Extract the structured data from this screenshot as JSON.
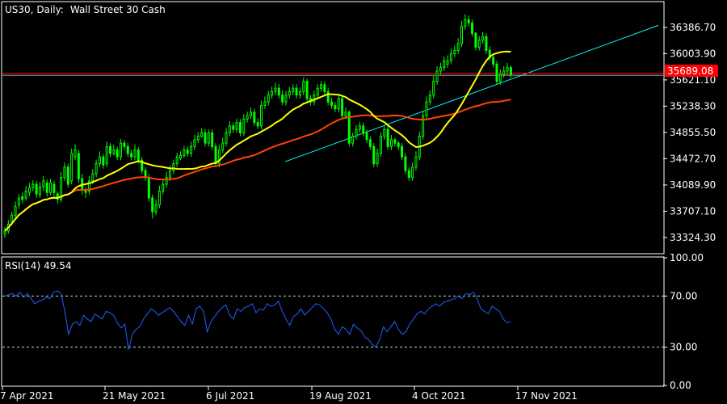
{
  "header": {
    "symbol": "US30",
    "timeframe": "Daily:",
    "instrument": "Wall Street 30 Cash"
  },
  "colors": {
    "background": "#000000",
    "frame": "#ffffff",
    "candle": "#00ff00",
    "ma_fast": "#ffff00",
    "ma_slow": "#ff4500",
    "trendline": "#00ffff",
    "price_line": "#ff0000",
    "rsi": "#1e60ff",
    "level_line": "#d3d3d3"
  },
  "chart_data": [
    {
      "type": "candlestick",
      "title": "US30, Daily:  Wall Street 30 Cash",
      "x_tick_labels": [
        "7 Apr 2021",
        "21 May 2021",
        "6 Jul 2021",
        "19 Aug 2021",
        "4 Oct 2021",
        "17 Nov 2021"
      ],
      "y_tick_labels": [
        "36386.70",
        "36003.90",
        "35621.10",
        "35238.30",
        "34855.50",
        "34472.70",
        "34089.90",
        "33707.10",
        "33324.30"
      ],
      "ylim": [
        33100,
        36750
      ],
      "current_price_label": "35689.08",
      "current_price": 35689.08,
      "horizontal_line": 35720,
      "trendline": {
        "from": [
          0.5,
          32960
        ],
        "to": [
          58.2,
          35550
        ]
      },
      "series": [
        {
          "type": "candle",
          "close": [
            33420,
            33520,
            33650,
            33780,
            33900,
            33880,
            34000,
            34050,
            34100,
            33960,
            34060,
            34150,
            33980,
            34120,
            33980,
            33880,
            34200,
            34350,
            34100,
            34550,
            34600,
            34180,
            34020,
            33980,
            34150,
            34250,
            34400,
            34500,
            34380,
            34650,
            34550,
            34600,
            34500,
            34700,
            34650,
            34550,
            34500,
            34600,
            34450,
            34300,
            34200,
            33900,
            33700,
            33800,
            34000,
            34100,
            34200,
            34300,
            34400,
            34500,
            34520,
            34600,
            34550,
            34650,
            34750,
            34800,
            34850,
            34700,
            34850,
            34650,
            34400,
            34600,
            34700,
            34850,
            34950,
            34900,
            35000,
            34850,
            35050,
            35100,
            35150,
            35000,
            34950,
            35250,
            35300,
            35400,
            35450,
            35500,
            35400,
            35300,
            35400,
            35450,
            35500,
            35400,
            35450,
            35600,
            35350,
            35300,
            35400,
            35500,
            35550,
            35450,
            35300,
            35250,
            35200,
            35350,
            35100,
            35150,
            34700,
            34800,
            34900,
            34950,
            34850,
            34750,
            34650,
            34400,
            34550,
            34800,
            34900,
            34650,
            34750,
            34700,
            34650,
            34500,
            34300,
            34200,
            34350,
            34500,
            34800,
            35100,
            35300,
            35400,
            35600,
            35750,
            35800,
            35900,
            35900,
            36000,
            36050,
            36150,
            36400,
            36500,
            36450,
            36300,
            36100,
            36200,
            36250,
            36050,
            35950,
            35850,
            35600,
            35700,
            35750,
            35800,
            35700
          ],
          "open": [
            33380,
            33420,
            33550,
            33650,
            33800,
            33920,
            33900,
            33980,
            34050,
            34100,
            33950,
            34060,
            34120,
            33980,
            34100,
            33960,
            33880,
            34200,
            34350,
            34150,
            34500,
            34550,
            34180,
            34020,
            34000,
            34150,
            34250,
            34400,
            34500,
            34400,
            34650,
            34550,
            34600,
            34500,
            34700,
            34650,
            34550,
            34500,
            34600,
            34450,
            34300,
            34200,
            33900,
            33700,
            33800,
            34000,
            34100,
            34200,
            34300,
            34400,
            34480,
            34520,
            34600,
            34550,
            34650,
            34750,
            34800,
            34850,
            34700,
            34850,
            34650,
            34400,
            34600,
            34700,
            34850,
            34950,
            34900,
            35000,
            34850,
            35050,
            35100,
            35150,
            35000,
            34950,
            35250,
            35300,
            35400,
            35450,
            35500,
            35400,
            35300,
            35400,
            35450,
            35500,
            35400,
            35450,
            35600,
            35350,
            35300,
            35400,
            35500,
            35550,
            35450,
            35300,
            35250,
            35200,
            35350,
            35100,
            35150,
            34700,
            34800,
            34900,
            34950,
            34850,
            34750,
            34650,
            34400,
            34550,
            34800,
            34900,
            34650,
            34750,
            34700,
            34650,
            34500,
            34300,
            34200,
            34350,
            34500,
            34800,
            35100,
            35300,
            35400,
            35600,
            35750,
            35800,
            35850,
            35900,
            36000,
            36050,
            36150,
            36400,
            36500,
            36450,
            36300,
            36100,
            36200,
            36250,
            36050,
            35950,
            35850,
            35600,
            35700,
            35750,
            35800
          ],
          "high": [
            33480,
            33580,
            33700,
            33850,
            33960,
            33980,
            34080,
            34120,
            34160,
            34150,
            34130,
            34220,
            34170,
            34180,
            34150,
            34000,
            34280,
            34420,
            34400,
            34620,
            34680,
            34600,
            34250,
            34060,
            34220,
            34320,
            34460,
            34580,
            34540,
            34720,
            34700,
            34680,
            34650,
            34760,
            34740,
            34700,
            34600,
            34680,
            34640,
            34500,
            34350,
            34250,
            33950,
            33880,
            34080,
            34180,
            34280,
            34380,
            34460,
            34560,
            34580,
            34660,
            34650,
            34720,
            34820,
            34860,
            34920,
            34900,
            34900,
            34900,
            34700,
            34680,
            34780,
            34920,
            35020,
            35000,
            35060,
            35050,
            35120,
            35160,
            35220,
            35200,
            35060,
            35320,
            35380,
            35460,
            35520,
            35580,
            35560,
            35460,
            35460,
            35520,
            35560,
            35560,
            35510,
            35660,
            35640,
            35400,
            35460,
            35560,
            35600,
            35600,
            35500,
            35360,
            35300,
            35420,
            35400,
            35220,
            35180,
            34850,
            34960,
            35010,
            35000,
            34900,
            34800,
            34700,
            34620,
            34860,
            34960,
            34950,
            34820,
            34780,
            34730,
            34700,
            34550,
            34340,
            34420,
            34580,
            34870,
            35170,
            35380,
            35470,
            35680,
            35820,
            35870,
            35960,
            35980,
            36080,
            36120,
            36230,
            36480,
            36580,
            36560,
            36500,
            36320,
            36260,
            36320,
            36300,
            36110,
            36000,
            35900,
            35780,
            35820,
            35870,
            35830
          ],
          "low": [
            33320,
            33380,
            33500,
            33600,
            33740,
            33820,
            33860,
            33930,
            34000,
            33900,
            33900,
            34000,
            33920,
            33940,
            33920,
            33820,
            33840,
            34150,
            34050,
            34100,
            34450,
            34120,
            33950,
            33900,
            33950,
            34100,
            34200,
            34350,
            34330,
            34350,
            34500,
            34520,
            34450,
            34450,
            34600,
            34500,
            34450,
            34450,
            34400,
            34250,
            34150,
            33850,
            33600,
            33650,
            33750,
            33950,
            34050,
            34150,
            34250,
            34350,
            34450,
            34480,
            34500,
            34500,
            34600,
            34700,
            34780,
            34650,
            34650,
            34600,
            34350,
            34350,
            34550,
            34650,
            34800,
            34850,
            34850,
            34800,
            34800,
            35000,
            35050,
            34950,
            34900,
            34900,
            35200,
            35250,
            35350,
            35400,
            35350,
            35250,
            35250,
            35350,
            35400,
            35350,
            35350,
            35400,
            35300,
            35250,
            35250,
            35350,
            35450,
            35400,
            35250,
            35200,
            35150,
            35150,
            35050,
            35050,
            34650,
            34650,
            34750,
            34850,
            34800,
            34700,
            34600,
            34350,
            34350,
            34500,
            34750,
            34600,
            34600,
            34650,
            34600,
            34450,
            34250,
            34150,
            34150,
            34300,
            34450,
            34750,
            35050,
            35250,
            35350,
            35550,
            35700,
            35750,
            35800,
            35850,
            35950,
            36000,
            36100,
            36350,
            36400,
            36250,
            36050,
            36050,
            36150,
            36000,
            35900,
            35800,
            35550,
            35550,
            35650,
            35700,
            35650
          ]
        },
        {
          "type": "line",
          "name": "",
          "role": "ma_fast"
        },
        {
          "type": "line",
          "name": "",
          "role": "ma_slow"
        }
      ]
    },
    {
      "type": "line",
      "title": "RSI(14) 49.54",
      "indicator_label": "RSI(14)",
      "indicator_value": "49.54",
      "y_tick_labels": [
        "100.00",
        "70.00",
        "30.00",
        "0.00"
      ],
      "ylim": [
        0,
        100
      ],
      "levels": [
        70,
        30
      ],
      "values": [
        70,
        71,
        72,
        70,
        73,
        69,
        72,
        68,
        64,
        66,
        67,
        69,
        68,
        73,
        74,
        72,
        58,
        40,
        48,
        50,
        47,
        55,
        52,
        50,
        56,
        54,
        52,
        58,
        57,
        55,
        49,
        45,
        48,
        28,
        40,
        44,
        46,
        52,
        56,
        60,
        58,
        55,
        57,
        59,
        61,
        58,
        54,
        50,
        47,
        55,
        48,
        60,
        62,
        58,
        42,
        50,
        54,
        58,
        61,
        63,
        55,
        52,
        60,
        58,
        61,
        62,
        64,
        57,
        60,
        59,
        64,
        62,
        63,
        66,
        58,
        52,
        47,
        54,
        56,
        60,
        55,
        58,
        61,
        64,
        63,
        60,
        57,
        52,
        44,
        40,
        46,
        44,
        40,
        48,
        45,
        43,
        38,
        36,
        32,
        30,
        36,
        46,
        42,
        46,
        50,
        44,
        40,
        42,
        48,
        52,
        56,
        58,
        56,
        60,
        62,
        64,
        62,
        65,
        66,
        67,
        68,
        70,
        68,
        72,
        71,
        73,
        68,
        60,
        58,
        56,
        62,
        60,
        58,
        52,
        49,
        50
      ],
      "x_tick_labels": [
        "7 Apr 2021",
        "21 May 2021",
        "6 Jul 2021",
        "19 Aug 2021",
        "4 Oct 2021",
        "17 Nov 2021"
      ]
    }
  ]
}
